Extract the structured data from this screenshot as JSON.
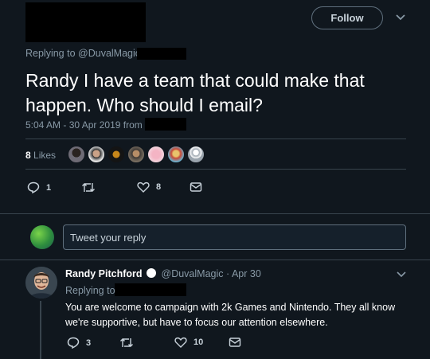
{
  "colors": {
    "background": "#10171e",
    "text": "#ffffff",
    "muted": "#8899a6",
    "border": "#38444d",
    "redaction": "#000000"
  },
  "header": {
    "follow_label": "Follow",
    "caret_icon": "chevron-down-icon"
  },
  "tweet": {
    "replying_prefix": "Replying to",
    "replying_handle": "@DuvalMagic",
    "text": "Randy I have a team that could make that happen. Who should I email?",
    "timestamp": "5:04 AM - 30 Apr 2019 from",
    "likes_count": "8",
    "likes_label": "Likes",
    "liker_avatars": [
      "avatar-1",
      "avatar-2",
      "avatar-3",
      "avatar-4",
      "avatar-5",
      "avatar-6",
      "avatar-7"
    ],
    "actions": {
      "reply_count": "1",
      "retweet_count": "",
      "like_count": "8"
    }
  },
  "composer": {
    "placeholder": "Tweet your reply"
  },
  "reply": {
    "name": "Randy Pitchford",
    "handle": "@DuvalMagic",
    "date": "Apr 30",
    "replying_prefix": "Replying to",
    "text": "You are welcome to campaign with 2k Games and Nintendo. They all know we're supportive, but have to focus our attention elsewhere.",
    "actions": {
      "reply_count": "3",
      "like_count": "10"
    }
  }
}
